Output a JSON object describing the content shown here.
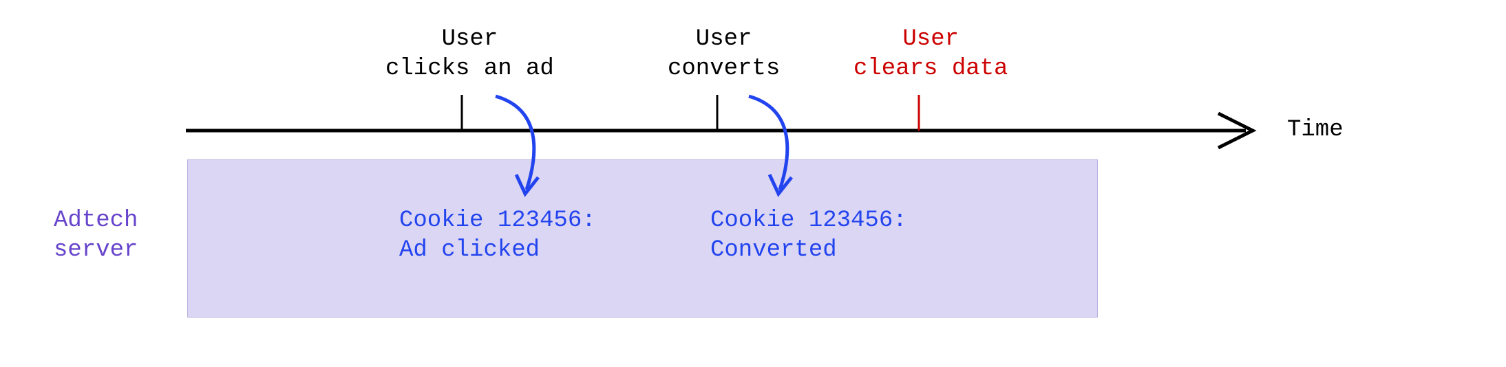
{
  "timeline": {
    "axis_label": "Time",
    "events": {
      "click": "User\nclicks an ad",
      "convert": "User\nconverts",
      "clear": "User\nclears data"
    }
  },
  "server": {
    "label": "Adtech\nserver",
    "cookie_click": "Cookie 123456:\nAd clicked",
    "cookie_convert": "Cookie 123456:\nConverted"
  },
  "colors": {
    "black": "#000000",
    "red": "#cc0000",
    "purple": "#6644cc",
    "blue": "#2244ee",
    "box_bg": "#dcd6f5",
    "box_border": "#b8b0e0"
  }
}
